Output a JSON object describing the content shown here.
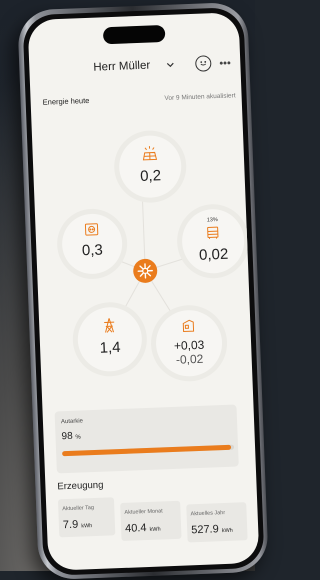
{
  "header": {
    "user_name": "Herr Müller",
    "chevron_icon": "chevron-down-icon",
    "profile_icon": "face-icon",
    "more_icon": "more-horizontal-icon",
    "more_glyph": "•••"
  },
  "energy_today": {
    "label": "Energie heute",
    "updated": "Vor 9 Minuten akualisiert"
  },
  "flow": {
    "solar": {
      "icon": "solar-panel-icon",
      "value": "0,2"
    },
    "house": {
      "icon": "house-outlet-icon",
      "value": "0,3"
    },
    "battery": {
      "icon": "battery-cabinet-icon",
      "percent": "13%",
      "value": "0,02"
    },
    "grid": {
      "icon": "power-pylon-icon",
      "value": "1,4"
    },
    "feed": {
      "icon": "building-icon",
      "value_in": "+0,03",
      "value_out": "-0,02"
    },
    "center_icon": "sun-hub-icon",
    "accent": "#ea7c1d"
  },
  "autarkie": {
    "label": "Autarkie",
    "value": "98",
    "unit": "%",
    "fraction": 0.98
  },
  "erzeugung": {
    "title": "Erzeugung",
    "stats": [
      {
        "label": "Aktueller Tag",
        "value": "7.9",
        "unit": "kWh"
      },
      {
        "label": "Aktueller Monat",
        "value": "40.4",
        "unit": "kWh"
      },
      {
        "label": "Aktuelles Jahr",
        "value": "527.9",
        "unit": "kWh"
      }
    ]
  }
}
